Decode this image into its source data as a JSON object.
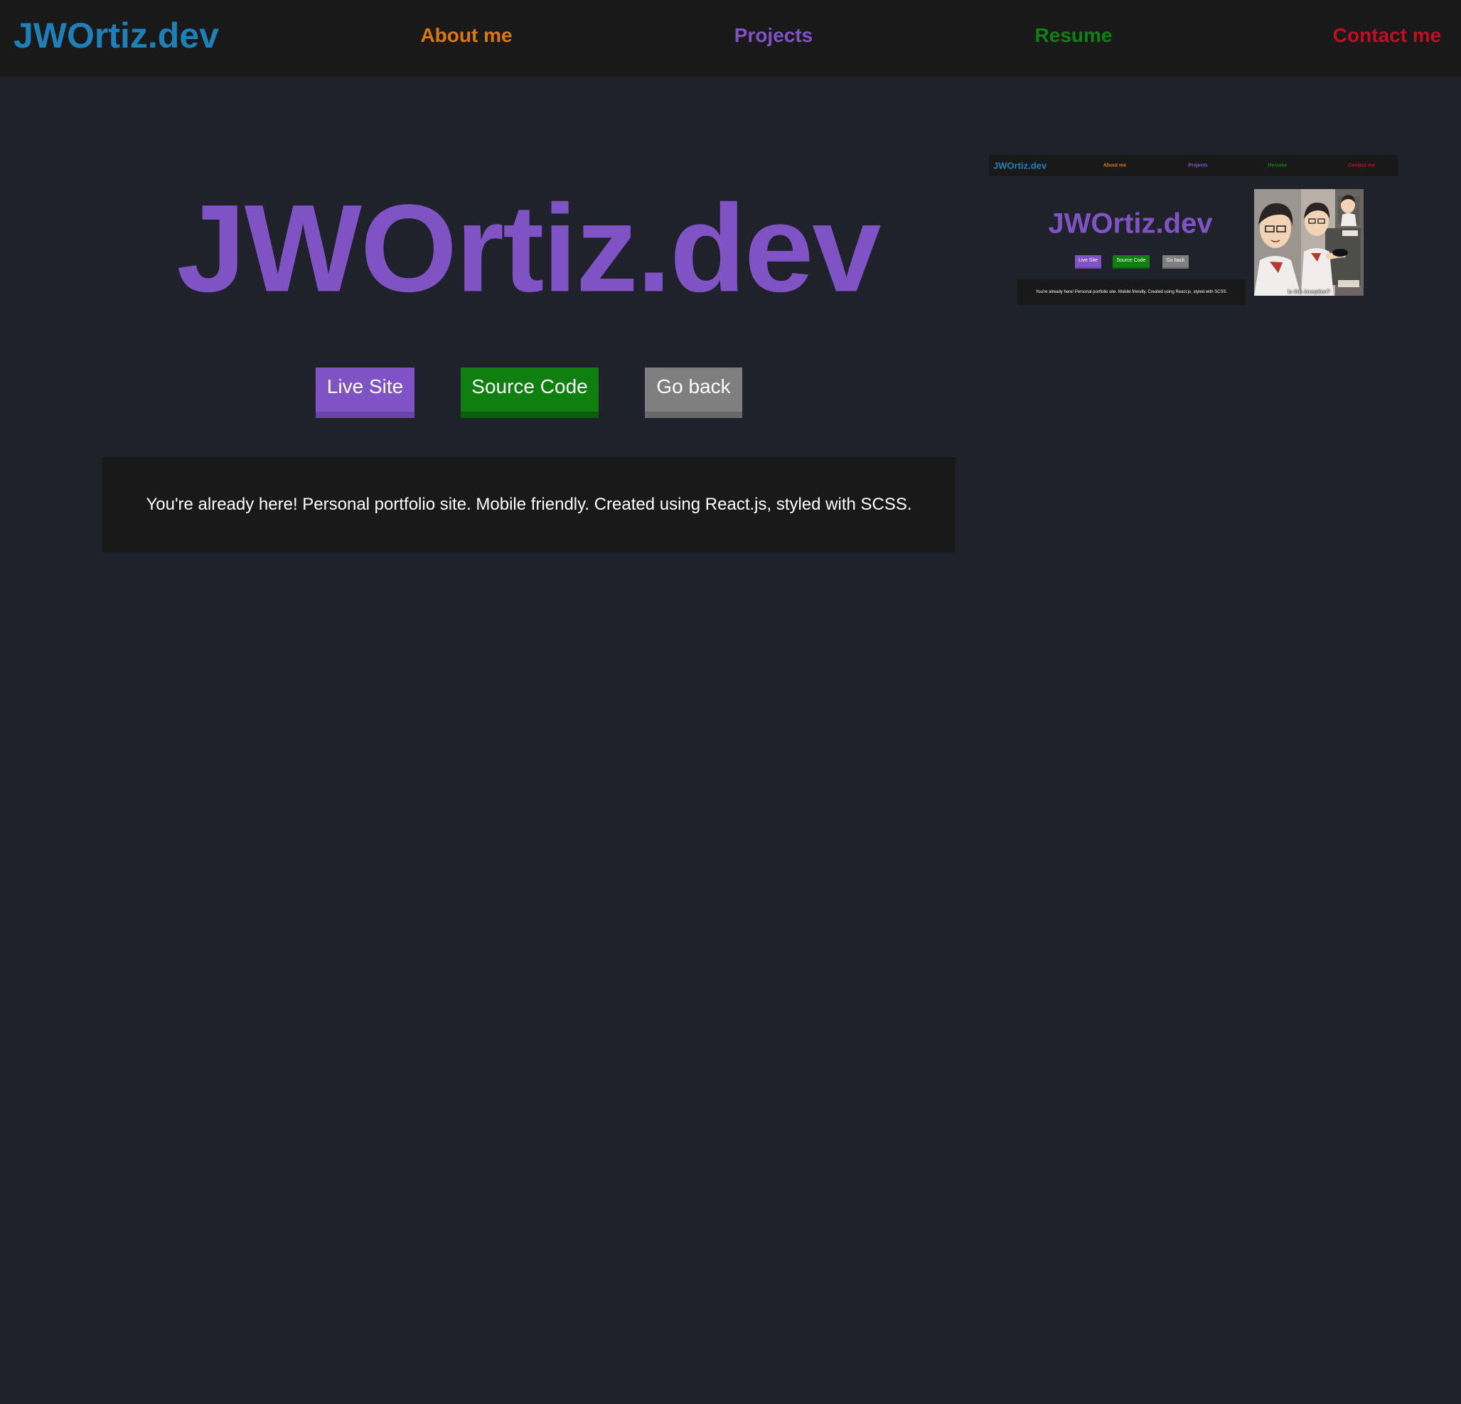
{
  "header": {
    "brand": "JWOrtiz.dev",
    "nav": {
      "about": "About me",
      "projects": "Projects",
      "resume": "Resume",
      "contact": "Contact me"
    }
  },
  "project": {
    "title": "JWOrtiz.dev",
    "buttons": {
      "live": "Live Site",
      "source": "Source Code",
      "back": "Go back"
    },
    "description": "You're already here! Personal portfolio site. Mobile friendly. Created using React.js, styled with SCSS."
  },
  "thumbnail": {
    "brand": "JWOrtiz.dev",
    "nav": {
      "about": "About me",
      "projects": "Projects",
      "resume": "Resume",
      "contact": "Contact me"
    },
    "title": "JWOrtiz.dev",
    "buttons": {
      "live": "Live Site",
      "source": "Source Code",
      "back": "Go back"
    },
    "description": "You're already here! Personal portfolio site. Mobile friendly. Created using React.js, styled with SCSS.",
    "meme_caption": "Is this inception?"
  },
  "colors": {
    "background": "#1f212b",
    "header": "#191919",
    "brand": "#1f7fb7",
    "about": "#d9780e",
    "projects": "#8053c5",
    "resume": "#118012",
    "contact": "#bf0f24",
    "button_live": "#8053c5",
    "button_source": "#0f800f",
    "button_back": "#7f7f7f"
  }
}
